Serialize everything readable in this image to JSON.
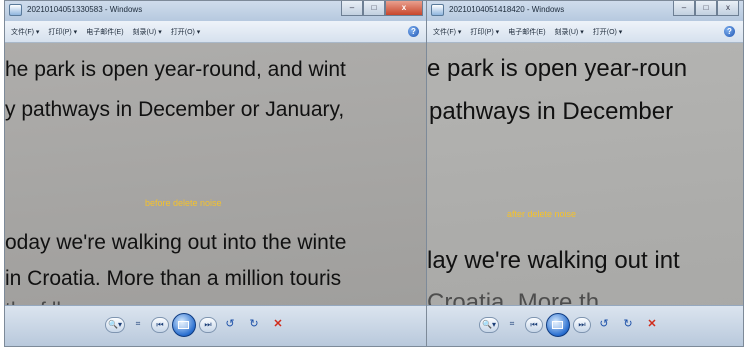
{
  "left_window": {
    "title": "20210104051330583 - Windows",
    "menu": [
      "文件(F) ▾",
      "打印(P) ▾",
      "电子邮件(E)",
      "刻录(U) ▾",
      "打开(O) ▾"
    ],
    "caption_buttons": {
      "minimize": "–",
      "maximize": "□",
      "close": "x"
    },
    "help": "?",
    "doc_lines": [
      "he park is open year-round, and wint",
      "y pathways in December or January,",
      "oday we're walking out into the winte",
      "in Croatia. More than a million touris",
      "   tha f ll          ."
    ],
    "overlay_label": "before delete noise",
    "controls": {
      "zoom": "🔍▾",
      "fit": "⌗",
      "prev": "⏮",
      "next": "⏭",
      "rotate_ccw": "↺",
      "rotate_cw": "↻",
      "delete": "✕"
    }
  },
  "right_window": {
    "title": "20210104051418420 - Windows",
    "menu": [
      "文件(F) ▾",
      "打印(P) ▾",
      "电子邮件(E)",
      "刻录(U) ▾",
      "打开(O) ▾"
    ],
    "caption_buttons": {
      "minimize": "–",
      "maximize": "□",
      "close": "x"
    },
    "help": "?",
    "doc_lines": [
      "e park is open year-roun",
      "pathways in December",
      "lay we're walking out int",
      "  Croatia. More th"
    ],
    "overlay_label": "after delete noise",
    "controls": {
      "zoom": "🔍▾",
      "fit": "⌗",
      "prev": "⏮",
      "next": "⏭",
      "rotate_ccw": "↺",
      "rotate_cw": "↻",
      "delete": "✕"
    }
  },
  "colors": {
    "overlay_text": "#f4c22c",
    "title_bar": "#b6c9df",
    "photo_bg": "#a8a7a5"
  }
}
